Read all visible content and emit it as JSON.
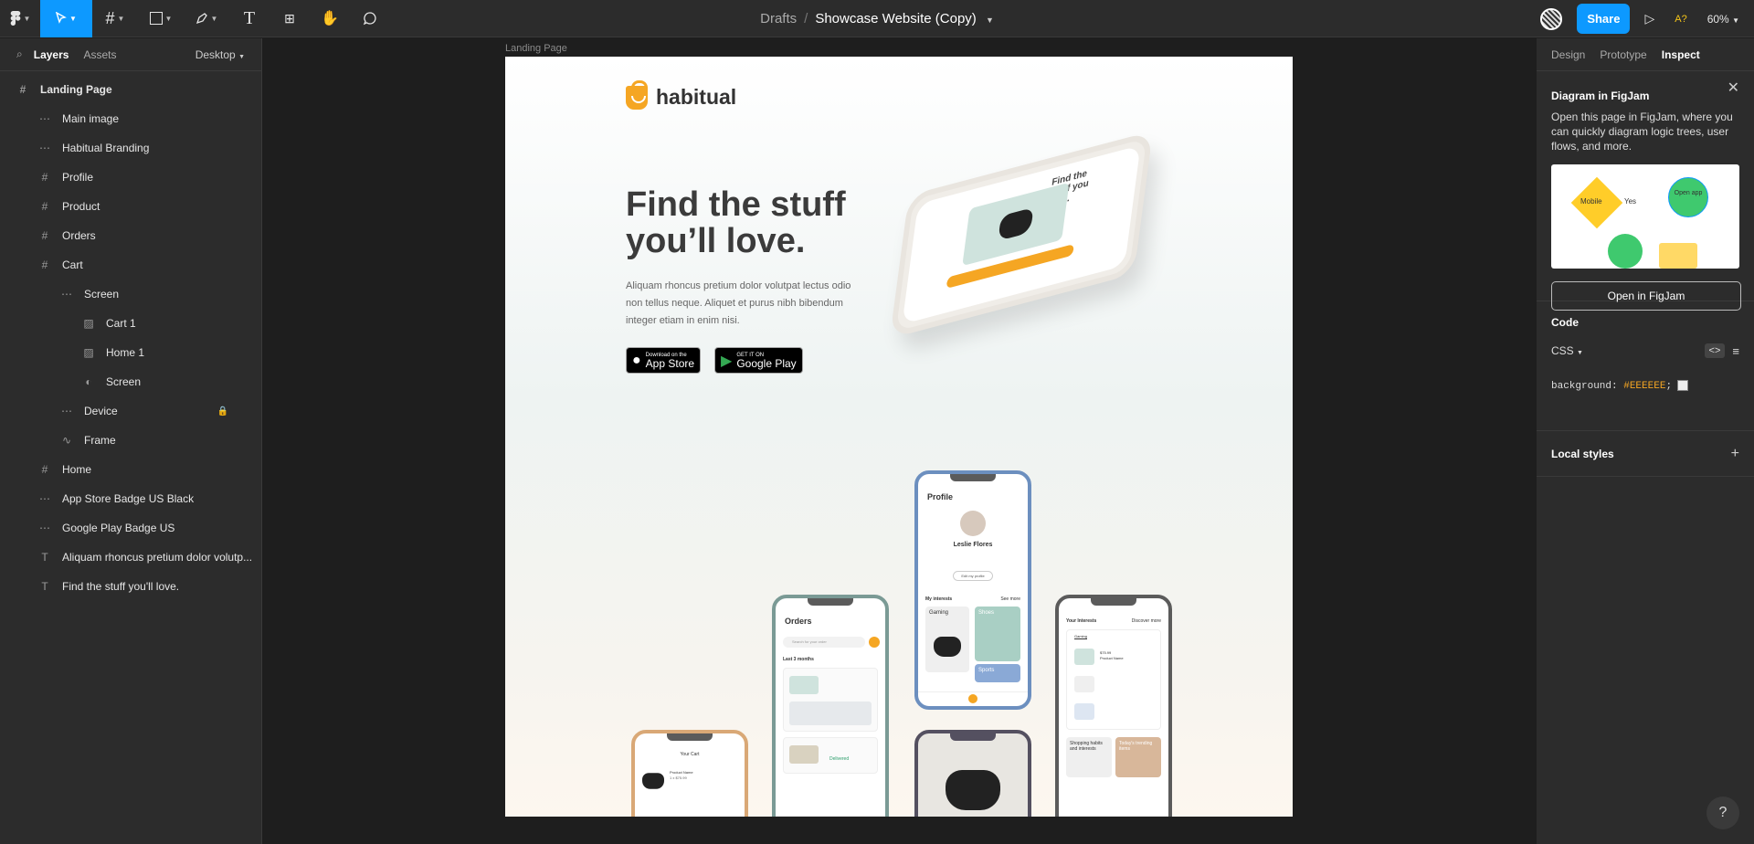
{
  "toolbar": {
    "title_drafts": "Drafts",
    "title_sep": "/",
    "file_name": "Showcase Website (Copy)",
    "share_label": "Share",
    "a11y_label": "A?",
    "zoom": "60%"
  },
  "left_panel": {
    "tab_layers": "Layers",
    "tab_assets": "Assets",
    "page_selector": "Desktop",
    "layers": [
      {
        "label": "Landing Page",
        "icon": "frame-icon"
      },
      {
        "label": "Main image",
        "icon": "group-icon"
      },
      {
        "label": "Habitual Branding",
        "icon": "group-icon"
      },
      {
        "label": "Profile",
        "icon": "frame-icon"
      },
      {
        "label": "Product",
        "icon": "frame-icon"
      },
      {
        "label": "Orders",
        "icon": "frame-icon"
      },
      {
        "label": "Cart",
        "icon": "frame-icon"
      },
      {
        "label": "Screen",
        "icon": "group-icon"
      },
      {
        "label": "Cart 1",
        "icon": "image-icon"
      },
      {
        "label": "Home 1",
        "icon": "image-icon"
      },
      {
        "label": "Screen",
        "icon": "mask-icon"
      },
      {
        "label": "Device",
        "icon": "group-icon"
      },
      {
        "label": "Frame",
        "icon": "vector-icon"
      },
      {
        "label": "Home",
        "icon": "frame-icon"
      },
      {
        "label": "App Store Badge US Black",
        "icon": "group-icon"
      },
      {
        "label": "Google Play Badge US",
        "icon": "group-icon"
      },
      {
        "label": "Aliquam rhoncus pretium dolor volutp...",
        "icon": "text-icon"
      },
      {
        "label": "Find the stuff you'll love.",
        "icon": "text-icon"
      }
    ]
  },
  "canvas": {
    "frame_label": "Landing Page",
    "logo_text": "habitual",
    "headline": "Find the stuff you’ll love.",
    "body": "Aliquam rhoncus pretium dolor volutpat lectus odio non tellus neque. Aliquet et purus nibh bibendum integer etiam in enim nisi.",
    "appstore_small": "Download on the",
    "appstore_big": "App Store",
    "googleplay_small": "GET IT ON",
    "googleplay_big": "Google Play",
    "tilted_title": "Find the stuff you love.",
    "phones": {
      "profile_title": "Profile",
      "profile_name": "Leslie Flores",
      "profile_edit": "Edit my profile",
      "profile_interests": "My interests",
      "profile_seemore": "See more",
      "profile_gaming": "Gaming",
      "profile_shoes": "Shoes",
      "profile_sports": "Sports",
      "orders_title": "Orders",
      "orders_search": "Search for your order",
      "orders_last": "Last 3 months",
      "orders_delivered": "Delivered",
      "cart_title": "Your Cart",
      "cart_item": "Product Name",
      "cart_price": "1 x $75.99",
      "interests_title": "Your Interests",
      "interests_discover": "Discover more",
      "interests_gaming": "Gaming",
      "interests_price": "$75.99",
      "interests_product": "Product Name",
      "interests_habits": "Shopping habits and interests",
      "interests_trending": "Today's trending items"
    }
  },
  "right_panel": {
    "tab_design": "Design",
    "tab_prototype": "Prototype",
    "tab_inspect": "Inspect",
    "figjam_title": "Diagram in FigJam",
    "figjam_text": "Open this page in FigJam, where you can quickly diagram logic trees, user flows, and more.",
    "figjam_mobile": "Mobile",
    "figjam_yes": "Yes",
    "figjam_open_app": "Open app",
    "figjam_button": "Open in FigJam",
    "code_title": "Code",
    "code_lang": "CSS",
    "code_prop": "background:",
    "code_value": "#EEEEEE",
    "code_semi": ";",
    "local_styles": "Local styles",
    "help": "?"
  },
  "colors": {
    "accent": "#0d99ff",
    "brand": "#f5a623",
    "panel": "#2c2c2c",
    "canvas": "#1e1e1e"
  }
}
